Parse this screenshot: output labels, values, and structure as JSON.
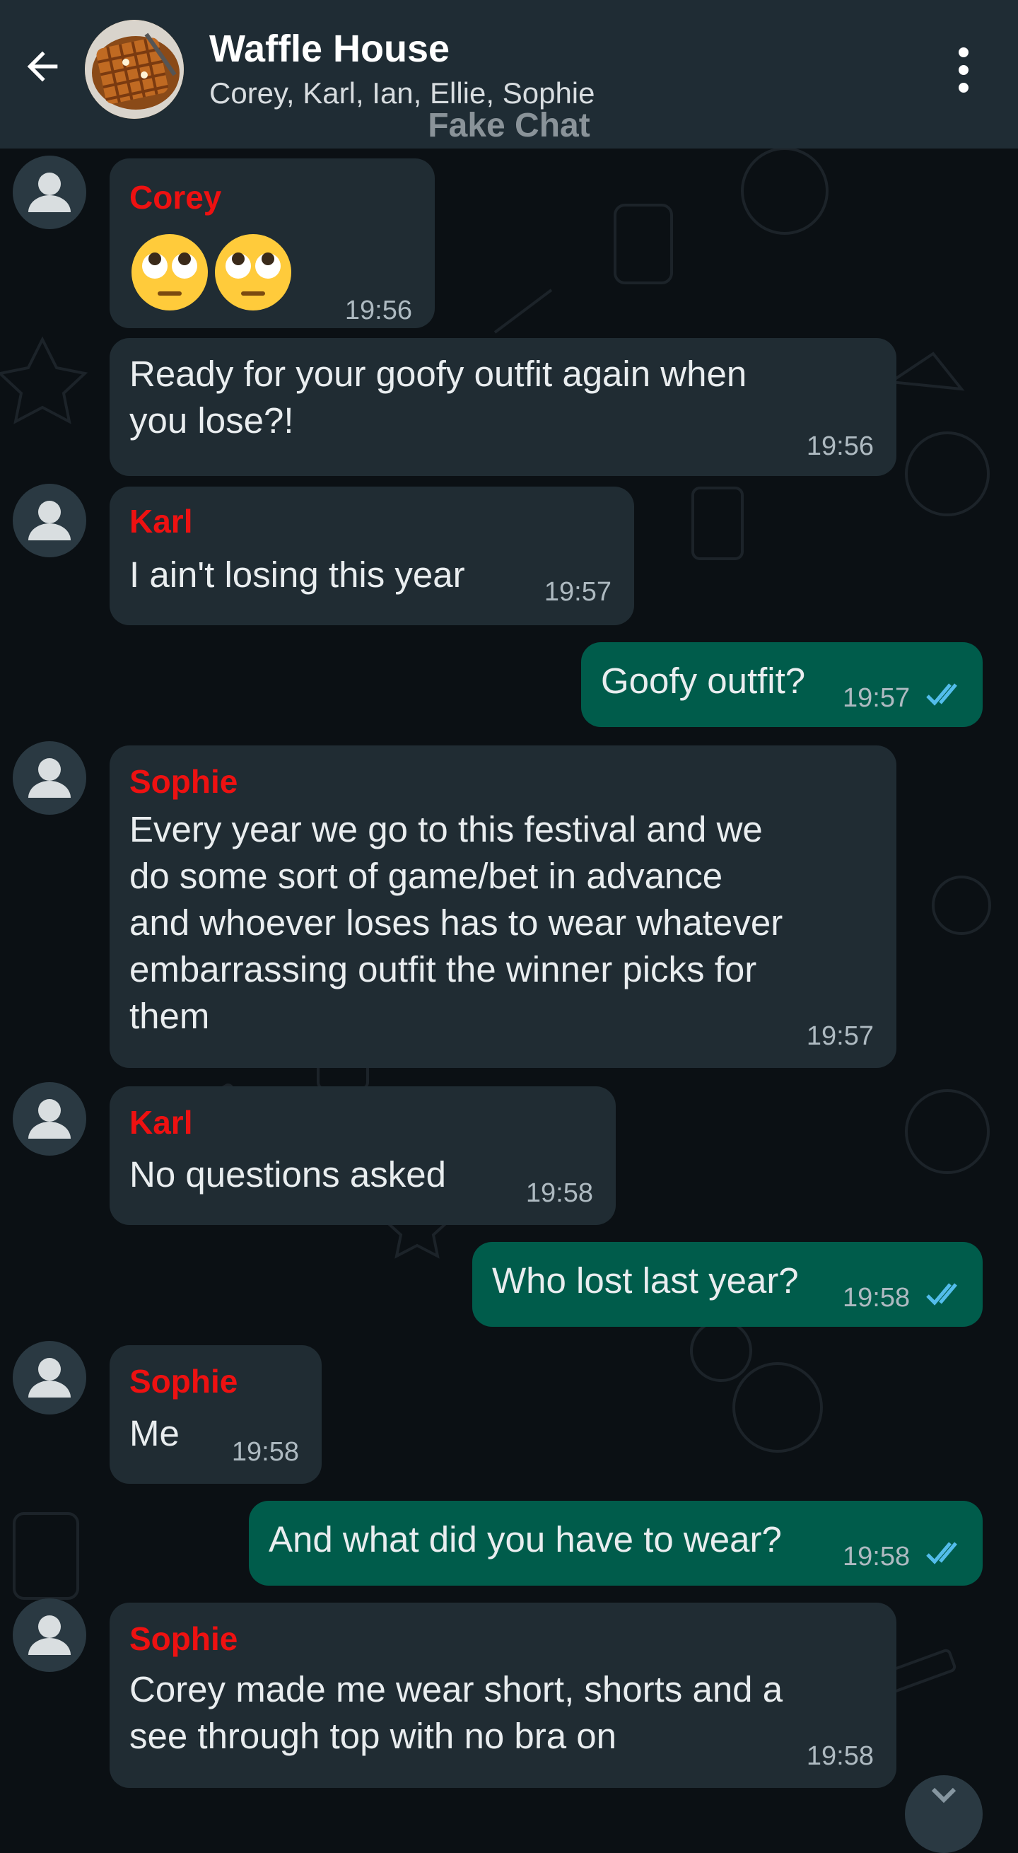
{
  "header": {
    "title": "Waffle House",
    "members": "Corey, Karl, Ian, Ellie, Sophie",
    "watermark": "Fake Chat"
  },
  "colors": {
    "header_bg": "#1f2c34",
    "chat_bg": "#0b1014",
    "incoming_bubble": "#202c33",
    "outgoing_bubble": "#005c4b",
    "sender_name": "#ee1111",
    "read_ticks": "#53bdeb"
  },
  "icons": {
    "back": "arrow-left-icon",
    "menu": "more-vertical-icon",
    "avatar": "person-icon",
    "read": "double-check-icon",
    "emoji": "face-with-rolling-eyes"
  },
  "messages": [
    {
      "sender": "Corey",
      "text": "",
      "emoji": "🙄🙄",
      "time": "19:56"
    },
    {
      "sender": "",
      "text": "Ready for your goofy outfit again when\nyou lose?!",
      "time": "19:56"
    },
    {
      "sender": "Karl",
      "text": "I ain't losing this year",
      "time": "19:57"
    },
    {
      "outgoing": true,
      "text": "Goofy outfit?",
      "time": "19:57",
      "status": "read"
    },
    {
      "sender": "Sophie",
      "text": "Every year we go to this festival and we\ndo some sort of game/bet in advance\nand whoever loses has to wear whatever\nembarrassing outfit the winner picks for\nthem",
      "time": "19:57"
    },
    {
      "sender": "Karl",
      "text": "No questions asked",
      "time": "19:58"
    },
    {
      "outgoing": true,
      "text": "Who lost last year?",
      "time": "19:58",
      "status": "read"
    },
    {
      "sender": "Sophie",
      "text": "Me",
      "time": "19:58"
    },
    {
      "outgoing": true,
      "text": "And what did you have to wear?",
      "time": "19:58",
      "status": "read"
    },
    {
      "sender": "Sophie",
      "text": "Corey made me wear short, shorts and a\nsee through top with no bra on",
      "time": "19:58"
    }
  ]
}
